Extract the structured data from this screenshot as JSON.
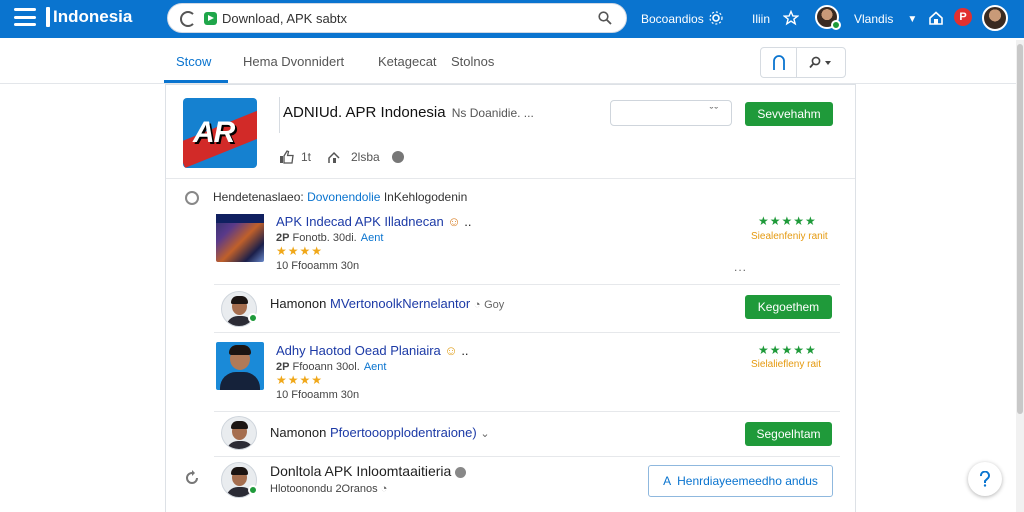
{
  "topbar": {
    "brand": "Indonesia",
    "search_value": "Download, APK sabtx",
    "links": [
      "Bocoandios",
      "Iliin"
    ],
    "user_name": "Vlandis",
    "notification_badge": "P",
    "colors": {
      "bar": "#0a74cf",
      "green": "#1f9a3a",
      "red": "#e23030"
    }
  },
  "tabs": [
    {
      "label": "Stcow",
      "active": true
    },
    {
      "label": "Hema Dvonnidert",
      "active": false
    },
    {
      "label": "Ketagecat",
      "active": false
    },
    {
      "label": "Stolnos",
      "active": false
    }
  ],
  "app": {
    "logo_text": "AR",
    "title": "ADNIUd. APR Indonesia",
    "title_suffix": "Ns Doanidie. ...",
    "select_caret": "ˇˇ",
    "action_button": "Sevvehahm",
    "stats": [
      "1t",
      "2lsba"
    ]
  },
  "section": {
    "prefix": "Hendetenaslaeo:",
    "link": "Dovonendolie",
    "suffix": "InKehlogodenin"
  },
  "rows": [
    {
      "title": "APK Indecad APK Illadnecan",
      "meta1_prefix": "2P",
      "meta1": "Fonotb. 30di.",
      "meta1_link": "Aent",
      "meta2": "10  Ffooamm  30n",
      "stars": "★★★★",
      "right_stars": "★★★★★",
      "right_label": "Siealenfeniy ranit",
      "more": "..."
    },
    {
      "prefix": "Hamonon",
      "title": "MVertonoolkNernelantor",
      "suffix": "Goy",
      "button": "Kegoethem"
    },
    {
      "title": "Adhy Haotod Oead Planiaira",
      "meta1_prefix": "2P",
      "meta1": "Ffooann 30ol.",
      "meta1_link": "Aent",
      "meta2": "10  Ffooamm  30n",
      "stars": "★★★★",
      "right_stars": "★★★★★",
      "right_label": "Sielaliefleny rait"
    },
    {
      "prefix": "Namonon",
      "title": "Pfoertooopplodentraione)",
      "suffix": "⌄",
      "button": "Segoelhtam"
    },
    {
      "title": "Donltola APK Inloomtaaitieria",
      "meta": "Hlotoonondu 2Oranos",
      "button": "Henrdiayeemeedho andus"
    }
  ]
}
